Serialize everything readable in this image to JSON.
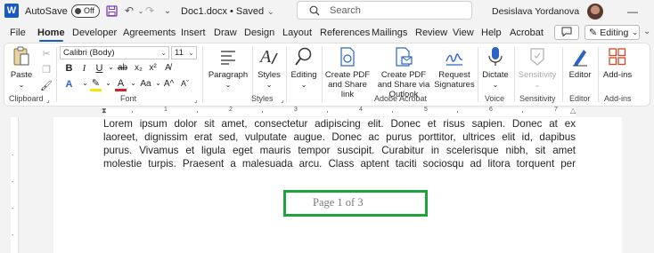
{
  "titlebar": {
    "logo_letter": "W",
    "autosave_label": "AutoSave",
    "autosave_state": "Off",
    "doc_title": "Doc1.docx • Saved",
    "doc_title_chevron": "⌄",
    "search_placeholder": "Search",
    "user_name": "Desislava Yordanova"
  },
  "menu": {
    "tabs": [
      "File",
      "Home",
      "Developer",
      "Agreements",
      "Insert",
      "Draw",
      "Design",
      "Layout",
      "References",
      "Mailings",
      "Review",
      "View",
      "Help",
      "Acrobat"
    ],
    "active_tab": "Home",
    "editing_label": "Editing"
  },
  "ribbon": {
    "clipboard": {
      "paste_label": "Paste",
      "group_label": "Clipboard"
    },
    "font": {
      "font_name": "Calibri (Body)",
      "font_size": "11",
      "group_label": "Font"
    },
    "paragraph": {
      "label": "Paragraph"
    },
    "styles": {
      "label": "Styles",
      "group_label": "Styles"
    },
    "editing": {
      "label": "Editing"
    },
    "acrobat": {
      "create_pdf_share_link": "Create PDF and Share link",
      "create_pdf_outlook": "Create PDF and Share via Outlook",
      "request_signatures": "Request Signatures",
      "group_label": "Adobe Acrobat"
    },
    "voice": {
      "dictate_label": "Dictate",
      "group_label": "Voice"
    },
    "sensitivity": {
      "label": "Sensitivity",
      "group_label": "Sensitivity"
    },
    "editor": {
      "label": "Editor",
      "group_label": "Editor"
    },
    "addins": {
      "label": "Add-ins",
      "group_label": "Add-ins"
    }
  },
  "ruler": {
    "numbers": [
      "1",
      "2",
      "3",
      "4",
      "5",
      "6",
      "7"
    ]
  },
  "document": {
    "lines": [
      "Lorem ipsum dolor sit amet, consectetur adipiscing elit. Donec et risus sapien. Donec at ex",
      "laoreet, dignissim erat sed, vulputate augue. Donec ac purus porttitor, ultrices elit id, dapibus",
      "purus. Vivamus et ligula eget mauris tempor suscipit. Curabitur in scelerisque nibh, sit amet",
      "molestie turpis. Praesent a malesuada arcu. Class aptent taciti sociosqu ad litora torquent per"
    ],
    "footer_text": "Page 1 of 3"
  },
  "colors": {
    "accent": "#185abd",
    "highlight_box": "#1da33b",
    "spell_underline": "#e03e2d"
  }
}
